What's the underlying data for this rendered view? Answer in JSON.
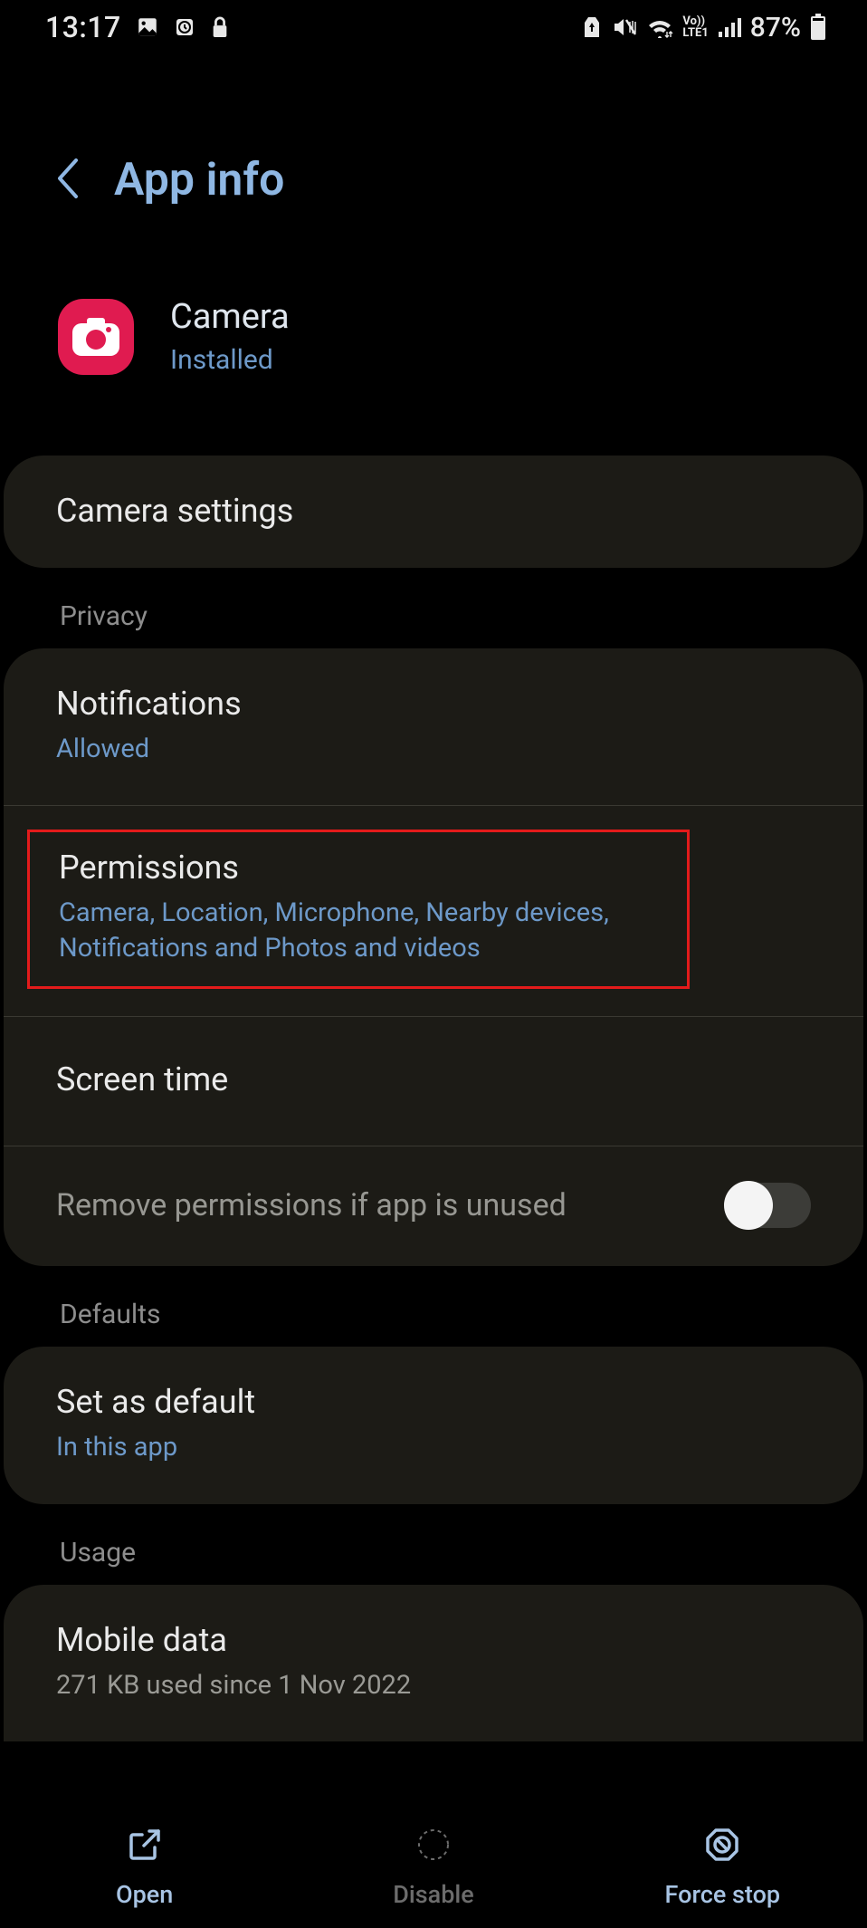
{
  "status": {
    "time": "13:17",
    "battery": "87%"
  },
  "header": {
    "title": "App info"
  },
  "app": {
    "name": "Camera",
    "status": "Installed"
  },
  "settings_row": {
    "label": "Camera settings"
  },
  "privacy": {
    "section": "Privacy",
    "notifications": {
      "title": "Notifications",
      "sub": "Allowed"
    },
    "permissions": {
      "title": "Permissions",
      "sub": "Camera, Location, Microphone, Nearby devices, Notifications and Photos and videos"
    },
    "screen_time": {
      "title": "Screen time"
    },
    "remove_perm": {
      "title": "Remove permissions if app is unused"
    }
  },
  "defaults": {
    "section": "Defaults",
    "set_default": {
      "title": "Set as default",
      "sub": "In this app"
    }
  },
  "usage": {
    "section": "Usage",
    "mobile_data": {
      "title": "Mobile data",
      "sub": "271 KB used since 1 Nov 2022"
    }
  },
  "nav": {
    "open": "Open",
    "disable": "Disable",
    "force_stop": "Force stop"
  }
}
